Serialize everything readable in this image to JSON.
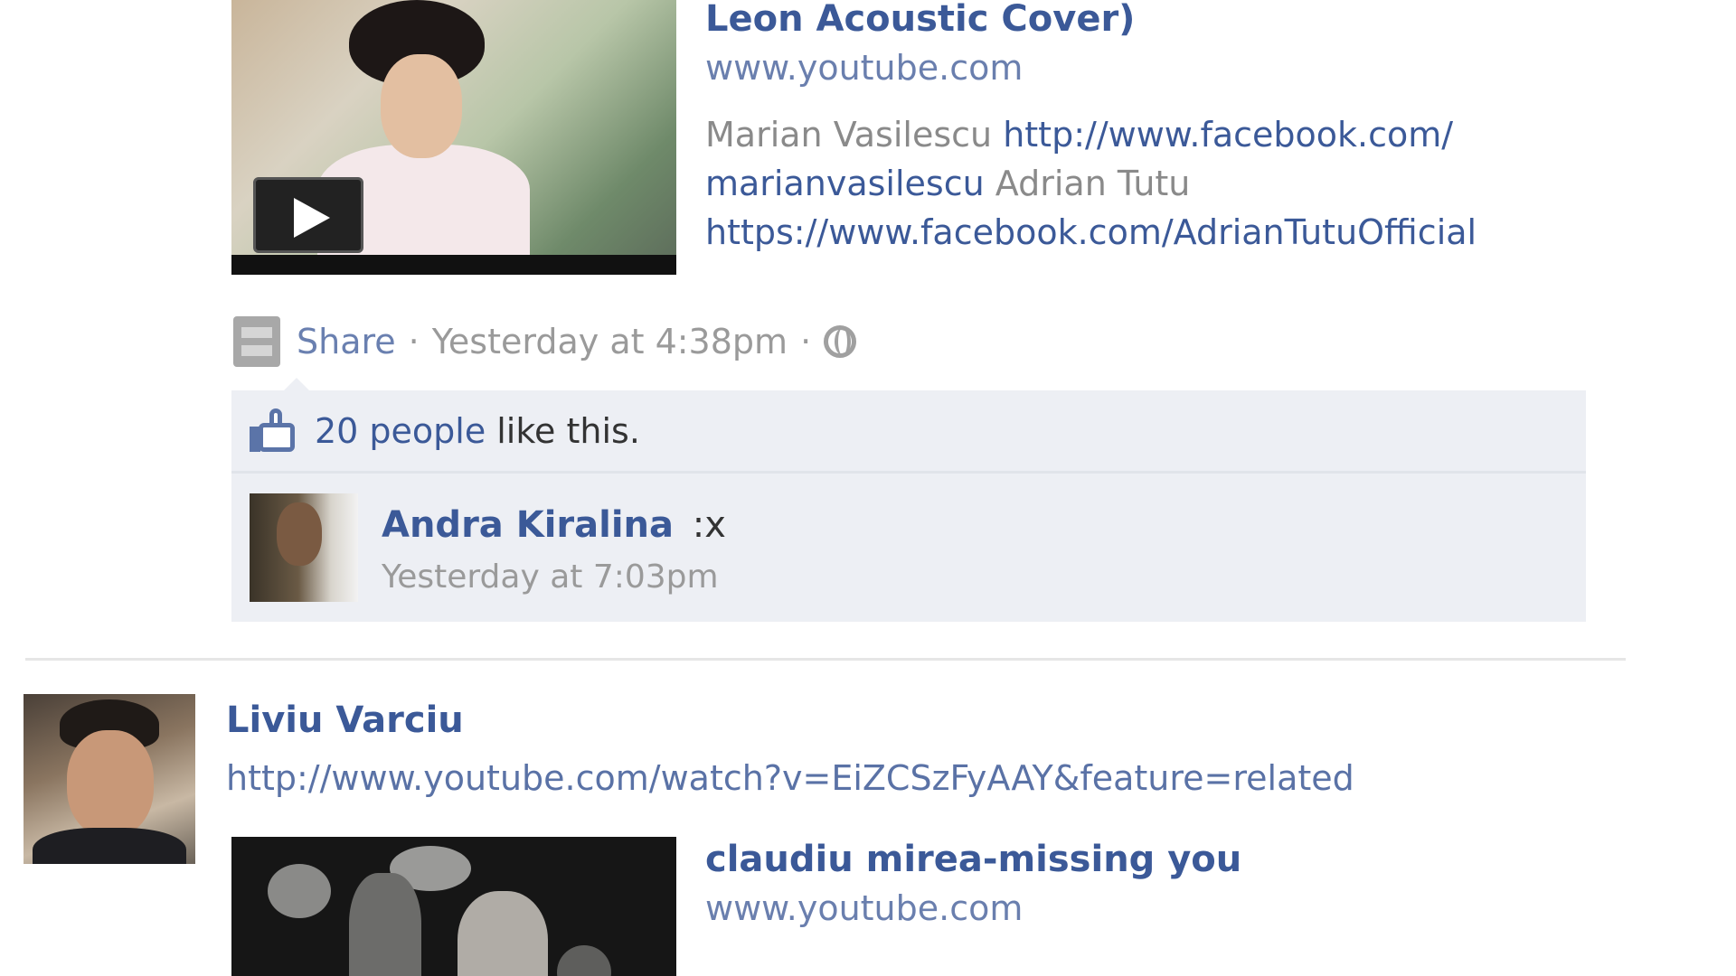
{
  "post1": {
    "link_title_tail": "Leon Acoustic Cover)",
    "link_domain": "www.youtube.com",
    "description": {
      "name1": "Marian Vasilescu",
      "url1_part1": "http://www.facebook.com/",
      "url1_part2": "marianvasilescu",
      "name2": "Adrian Tutu",
      "url2": "https://www.facebook.com/AdrianTutuOfficial"
    },
    "meta": {
      "share_label": "Share",
      "separator": "·",
      "timestamp": "Yesterday at 4:38pm"
    },
    "likes": {
      "count_label": "20 people",
      "suffix": "like this."
    },
    "comment": {
      "author": "Andra Kiralina",
      "text": ":x",
      "timestamp": "Yesterday at 7:03pm"
    }
  },
  "post2": {
    "author": "Liviu Varciu",
    "url": "http://www.youtube.com/watch?v=EiZCSzFyAAY&feature=related",
    "link_title": "claudiu mirea-missing you",
    "link_domain": "www.youtube.com"
  },
  "icons": {
    "play": "play-icon",
    "share": "share-icon",
    "globe": "globe-icon",
    "like": "thumbs-up-icon"
  },
  "colors": {
    "link": "#3b5998",
    "muted": "#8a8a8a",
    "ufi_background": "#edeff4"
  }
}
